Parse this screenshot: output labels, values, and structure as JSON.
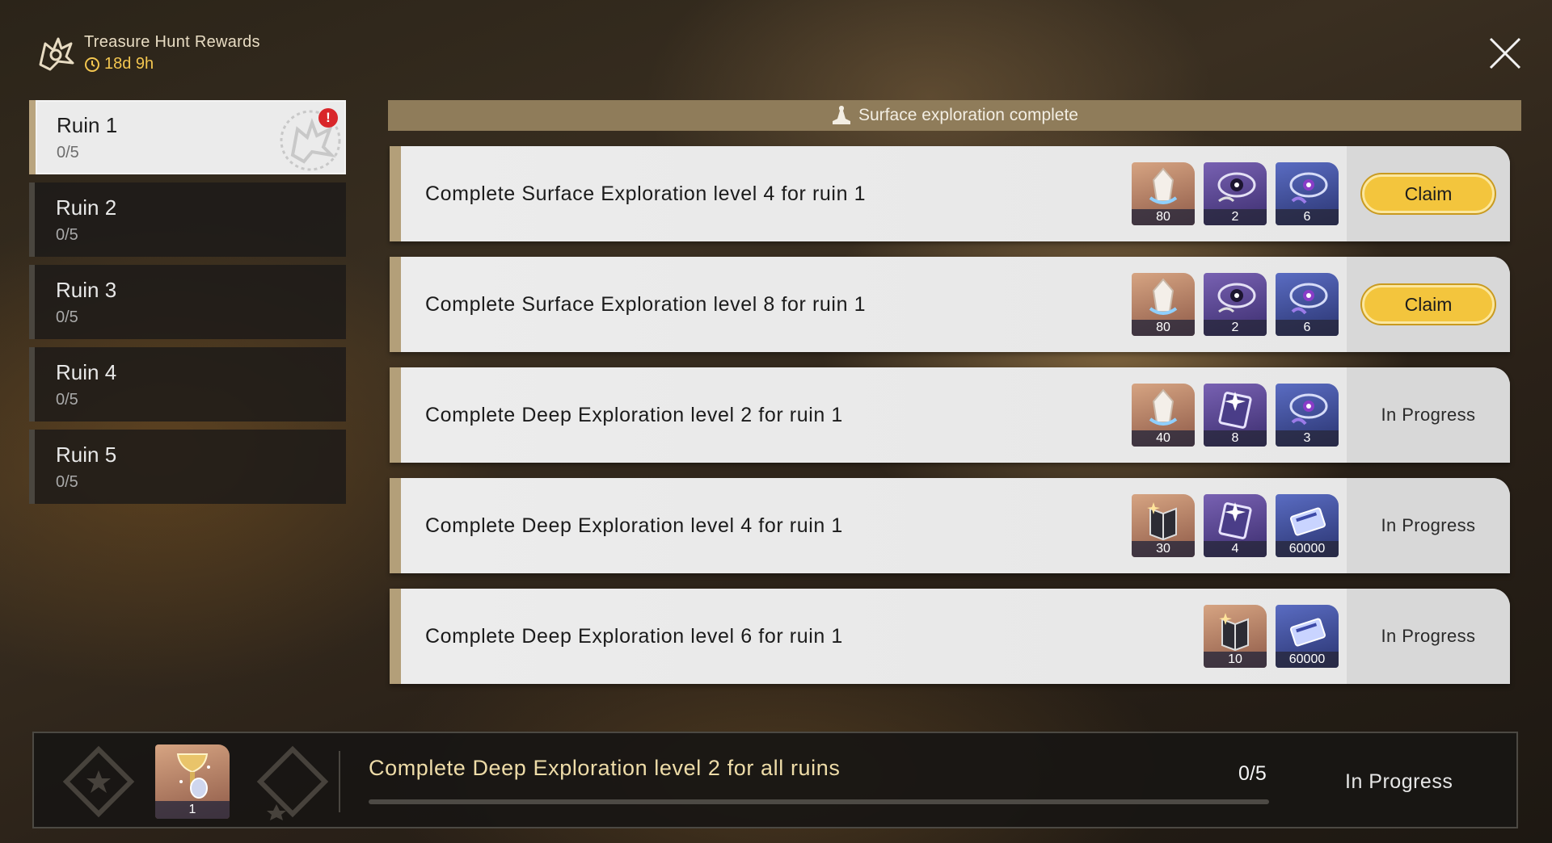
{
  "header": {
    "title": "Treasure Hunt Rewards",
    "timer": "18d 9h"
  },
  "sidebar": {
    "items": [
      {
        "name": "Ruin 1",
        "progress": "0/5",
        "selected": true,
        "alert": "!"
      },
      {
        "name": "Ruin 2",
        "progress": "0/5",
        "selected": false
      },
      {
        "name": "Ruin 3",
        "progress": "0/5",
        "selected": false
      },
      {
        "name": "Ruin 4",
        "progress": "0/5",
        "selected": false
      },
      {
        "name": "Ruin 5",
        "progress": "0/5",
        "selected": false
      }
    ]
  },
  "banner": {
    "text": "Surface exploration complete",
    "icon": "mountain-icon"
  },
  "quests": [
    {
      "description": "Complete Surface Exploration level 4 for ruin 1",
      "rewards": [
        {
          "icon": "crystal-icon",
          "count": "80",
          "rarity": "orange"
        },
        {
          "icon": "orb-icon",
          "count": "2",
          "rarity": "purple"
        },
        {
          "icon": "orb-icon",
          "count": "6",
          "rarity": "blue"
        }
      ],
      "action": "Claim"
    },
    {
      "description": "Complete Surface Exploration level 8 for ruin 1",
      "rewards": [
        {
          "icon": "crystal-icon",
          "count": "80",
          "rarity": "orange"
        },
        {
          "icon": "orb-icon",
          "count": "2",
          "rarity": "purple"
        },
        {
          "icon": "orb-icon",
          "count": "6",
          "rarity": "blue"
        }
      ],
      "action": "Claim"
    },
    {
      "description": "Complete Deep Exploration level 2 for ruin 1",
      "rewards": [
        {
          "icon": "crystal-icon",
          "count": "40",
          "rarity": "orange"
        },
        {
          "icon": "data-card-icon",
          "count": "8",
          "rarity": "purple"
        },
        {
          "icon": "orb-icon",
          "count": "3",
          "rarity": "blue"
        }
      ],
      "action": "In Progress"
    },
    {
      "description": "Complete Deep Exploration level 4 for ruin 1",
      "rewards": [
        {
          "icon": "book-icon",
          "count": "30",
          "rarity": "orange"
        },
        {
          "icon": "data-card-icon",
          "count": "4",
          "rarity": "purple"
        },
        {
          "icon": "coin-pack-icon",
          "count": "60000",
          "rarity": "blue"
        }
      ],
      "action": "In Progress"
    },
    {
      "description": "Complete Deep Exploration level 6 for ruin 1",
      "rewards": [
        {
          "icon": "book-icon",
          "count": "10",
          "rarity": "orange"
        },
        {
          "icon": "coin-pack-icon",
          "count": "60000",
          "rarity": "blue"
        }
      ],
      "action": "In Progress"
    }
  ],
  "final_quest": {
    "description": "Complete Deep Exploration level 2 for all ruins",
    "reward": {
      "icon": "trophy-icon",
      "count": "1",
      "rarity": "orange"
    },
    "progress_text": "0/5",
    "progress_fraction": 0,
    "status": "In Progress"
  },
  "colors": {
    "accent_gold": "#f3c53d",
    "timer_yellow": "#f3c650",
    "quest_border": "#b39f79",
    "banner": "#8f7c5a",
    "alert_red": "#d9262a"
  }
}
